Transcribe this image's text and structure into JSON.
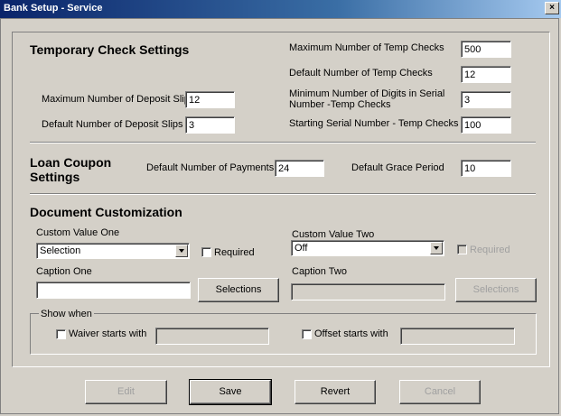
{
  "window": {
    "title": "Bank Setup - Service",
    "close_glyph": "×"
  },
  "temp_check": {
    "title": "Temporary Check Settings",
    "max_temp_checks": {
      "label": "Maximum Number of Temp Checks",
      "value": "500"
    },
    "default_temp_checks": {
      "label": "Default Number of Temp Checks",
      "value": "12"
    },
    "min_digits_serial": {
      "label_line1": "Minimum Number of Digits in Serial",
      "label_line2": "Number -Temp Checks",
      "value": "3"
    },
    "starting_serial": {
      "label": "Starting Serial Number - Temp Checks",
      "value": "100"
    },
    "max_deposit_slips": {
      "label": "Maximum Number of Deposit Slips",
      "value": "12"
    },
    "default_deposit_slips": {
      "label": "Default Number of Deposit Slips",
      "value": "3"
    }
  },
  "loan_coupon": {
    "title_line1": "Loan Coupon",
    "title_line2": "Settings",
    "default_payments": {
      "label": "Default Number of Payments",
      "value": "24"
    },
    "grace_period": {
      "label": "Default Grace Period",
      "value": "10"
    }
  },
  "doc_custom": {
    "title": "Document Customization",
    "custom_value_one": {
      "label": "Custom Value One",
      "selected": "Selection"
    },
    "custom_value_two": {
      "label": "Custom Value Two",
      "selected": "Off"
    },
    "required_label": "Required",
    "caption_one": {
      "label": "Caption One",
      "value": ""
    },
    "caption_two": {
      "label": "Caption Two",
      "value": ""
    },
    "selections_label": "Selections",
    "show_when": {
      "legend": "Show when",
      "waiver_label": "Waiver starts with",
      "offset_label": "Offset starts with"
    }
  },
  "buttons": {
    "edit": "Edit",
    "save": "Save",
    "revert": "Revert",
    "cancel": "Cancel"
  }
}
